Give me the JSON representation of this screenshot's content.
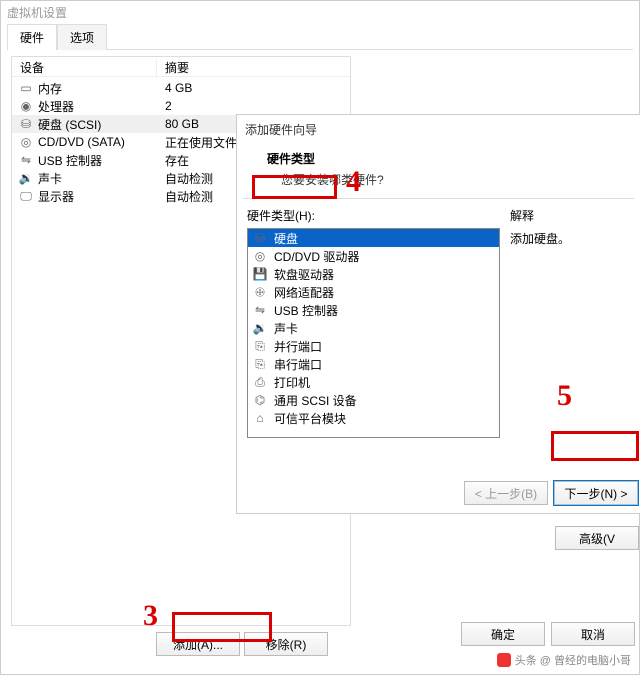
{
  "window_title": "虚拟机设置",
  "tabs": {
    "hardware": "硬件",
    "options": "选项"
  },
  "columns": {
    "device": "设备",
    "summary": "摘要"
  },
  "devices": [
    {
      "icon": "memory-icon",
      "name": "内存",
      "summary": "4 GB"
    },
    {
      "icon": "cpu-icon",
      "name": "处理器",
      "summary": "2"
    },
    {
      "icon": "disk-icon",
      "name": "硬盘 (SCSI)",
      "summary": "80 GB",
      "selected": true
    },
    {
      "icon": "cd-icon",
      "name": "CD/DVD (SATA)",
      "summary": "正在使用文件"
    },
    {
      "icon": "usb-icon",
      "name": "USB 控制器",
      "summary": "存在"
    },
    {
      "icon": "sound-icon",
      "name": "声卡",
      "summary": "自动检测"
    },
    {
      "icon": "display-icon",
      "name": "显示器",
      "summary": "自动检测"
    }
  ],
  "buttons": {
    "add": "添加(A)...",
    "remove": "移除(R)",
    "ok": "确定",
    "cancel": "取消",
    "advanced": "高级(V"
  },
  "wizard": {
    "title": "添加硬件向导",
    "heading": "硬件类型",
    "subheading": "您要安装哪类硬件?",
    "list_label": "硬件类型(H):",
    "right_label": "解释",
    "right_text": "添加硬盘。",
    "items": [
      {
        "icon": "disk-icon",
        "label": "硬盘",
        "selected": true
      },
      {
        "icon": "cd-icon",
        "label": "CD/DVD 驱动器"
      },
      {
        "icon": "floppy-icon",
        "label": "软盘驱动器"
      },
      {
        "icon": "net-icon",
        "label": "网络适配器"
      },
      {
        "icon": "usb-icon",
        "label": "USB 控制器"
      },
      {
        "icon": "sound-icon",
        "label": "声卡"
      },
      {
        "icon": "parallel-icon",
        "label": "并行端口"
      },
      {
        "icon": "serial-icon",
        "label": "串行端口"
      },
      {
        "icon": "printer-icon",
        "label": "打印机"
      },
      {
        "icon": "scsi-icon",
        "label": "通用 SCSI 设备"
      },
      {
        "icon": "tpm-icon",
        "label": "可信平台模块"
      }
    ],
    "back": "< 上一步(B)",
    "next": "下一步(N) >"
  },
  "annotations": {
    "n3": "3",
    "n4": "4",
    "n5": "5"
  },
  "watermark": "头条 @ 曾经的电脑小哥"
}
